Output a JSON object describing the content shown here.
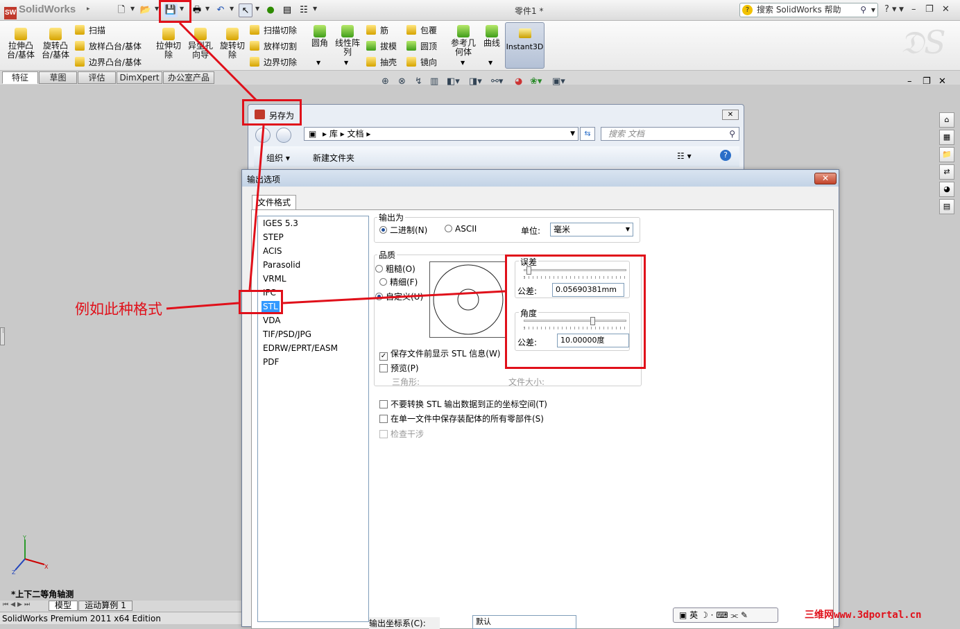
{
  "app": {
    "name": "SolidWorks",
    "document_title": "零件1 *",
    "help_search_placeholder": "搜索 SolidWorks 帮助"
  },
  "commands": {
    "extrude_boss": "拉伸凸\n台/基体",
    "revolve_boss": "旋转凸\n台/基体",
    "sweep": "扫描",
    "loft": "放样凸台/基体",
    "boundary_boss": "边界凸台/基体",
    "extrude_cut": "拉伸切\n除",
    "hole_wizard": "异型孔\n向导",
    "revolve_cut": "旋转切\n除",
    "swept_cut": "扫描切除",
    "lofted_cut": "放样切割",
    "boundary_cut": "边界切除",
    "fillet": "圆角",
    "linear_pattern": "线性阵\n列",
    "rib": "筋",
    "draft": "拔模",
    "shell": "抽壳",
    "wrap": "包覆",
    "dome": "圆顶",
    "mirror": "镜向",
    "ref_geometry": "参考几\n何体",
    "curves": "曲线",
    "instant3d": "Instant3D"
  },
  "tabs": [
    "特征",
    "草图",
    "评估",
    "DimXpert",
    "办公室产品"
  ],
  "saveas": {
    "title": "另存为",
    "path": [
      "库",
      "文档"
    ],
    "search_placeholder": "搜索 文档",
    "organize": "组织",
    "new_folder": "新建文件夹"
  },
  "export": {
    "title": "输出选项",
    "tab": "文件格式",
    "formats": [
      "IGES 5.3",
      "STEP",
      "ACIS",
      "Parasolid",
      "VRML",
      "IFC",
      "STL",
      "VDA",
      "TIF/PSD/JPG",
      "EDRW/EPRT/EASM",
      "PDF"
    ],
    "selected_format": "STL",
    "output_as_label": "输出为",
    "binary": "二进制(N)",
    "ascii": "ASCII",
    "unit_label": "单位:",
    "unit_value": "毫米",
    "quality_label": "品质",
    "coarse": "粗糙(O)",
    "fine": "精细(F)",
    "custom": "自定义(U)",
    "deviation_label": "误差",
    "deviation_tol_label": "公差:",
    "deviation_value": "0.05690381mm",
    "angle_label": "角度",
    "angle_tol_label": "公差:",
    "angle_value": "10.00000度",
    "show_info": "保存文件前显示 STL 信息(W)",
    "preview": "预览(P)",
    "triangles": "三角形:",
    "file_size": "文件大小:",
    "no_translate": "不要转换 STL 输出数据到正的坐标空间(T)",
    "single_file": "在单一文件中保存装配体的所有零部件(S)",
    "check_interference": "检查干涉",
    "output_coord": "输出坐标系(C):",
    "coord_value": "默认"
  },
  "annotation": "例如此种格式",
  "view_label": "*上下二等角轴测",
  "model_tabs": [
    "模型",
    "运动算例 1"
  ],
  "status": "SolidWorks Premium 2011 x64 Edition",
  "ime": "英",
  "watermark": "三维网www.3dportal.cn"
}
